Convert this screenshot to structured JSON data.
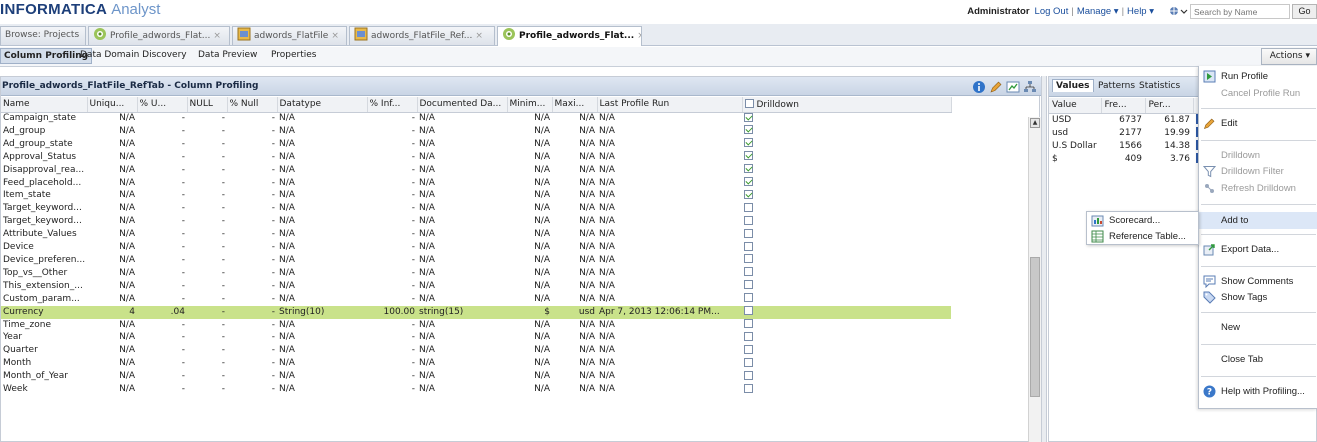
{
  "header": {
    "brand": "INFORMATICA",
    "app_name": "Analyst",
    "user": "Administrator",
    "links": [
      "Log Out",
      "Manage ▾",
      "Help ▾"
    ],
    "search_placeholder": "Search by Name",
    "go_label": "Go"
  },
  "tabs": [
    {
      "label": "Browse: Projects",
      "close": ""
    },
    {
      "label": "Profile_adwords_Flat...",
      "close": "×",
      "icon": "profile-icon"
    },
    {
      "label": "adwords_FlatFile",
      "close": "×",
      "icon": "flatfile-icon"
    },
    {
      "label": "adwords_FlatFile_Ref...",
      "close": "×",
      "icon": "flatfile-icon"
    },
    {
      "label": "Profile_adwords_Flat...",
      "close": "×",
      "icon": "profile-icon",
      "active": true
    }
  ],
  "subnav": {
    "items": [
      "Column Profiling",
      "Data Domain Discovery",
      "Data Preview",
      "Properties"
    ],
    "actions_label": "Actions ▾"
  },
  "panel": {
    "title": "Profile_adwords_FlatFile_RefTab - Column Profiling"
  },
  "grid": {
    "columns": [
      "Name",
      "Uniqu...",
      "% U...",
      "NULL",
      "% Null",
      "Datatype",
      "% Inf...",
      "Documented Da...",
      "Minim...",
      "Maxi...",
      "Last Profile Run",
      "Drilldown"
    ],
    "rows": [
      {
        "name": "Campaign_state",
        "unique": "N/A",
        "pu": "-",
        "null": "-",
        "pnull": "-",
        "datatype": "N/A",
        "pinf": "-",
        "documented": "N/A",
        "min": "N/A",
        "max": "N/A",
        "lastrun": "N/A",
        "drill": true
      },
      {
        "name": "Ad_group",
        "unique": "N/A",
        "pu": "-",
        "null": "-",
        "pnull": "-",
        "datatype": "N/A",
        "pinf": "-",
        "documented": "N/A",
        "min": "N/A",
        "max": "N/A",
        "lastrun": "N/A",
        "drill": true
      },
      {
        "name": "Ad_group_state",
        "unique": "N/A",
        "pu": "-",
        "null": "-",
        "pnull": "-",
        "datatype": "N/A",
        "pinf": "-",
        "documented": "N/A",
        "min": "N/A",
        "max": "N/A",
        "lastrun": "N/A",
        "drill": true
      },
      {
        "name": "Approval_Status",
        "unique": "N/A",
        "pu": "-",
        "null": "-",
        "pnull": "-",
        "datatype": "N/A",
        "pinf": "-",
        "documented": "N/A",
        "min": "N/A",
        "max": "N/A",
        "lastrun": "N/A",
        "drill": true
      },
      {
        "name": "Disapproval_rea...",
        "unique": "N/A",
        "pu": "-",
        "null": "-",
        "pnull": "-",
        "datatype": "N/A",
        "pinf": "-",
        "documented": "N/A",
        "min": "N/A",
        "max": "N/A",
        "lastrun": "N/A",
        "drill": true
      },
      {
        "name": "Feed_placehold...",
        "unique": "N/A",
        "pu": "-",
        "null": "-",
        "pnull": "-",
        "datatype": "N/A",
        "pinf": "-",
        "documented": "N/A",
        "min": "N/A",
        "max": "N/A",
        "lastrun": "N/A",
        "drill": true
      },
      {
        "name": "Item_state",
        "unique": "N/A",
        "pu": "-",
        "null": "-",
        "pnull": "-",
        "datatype": "N/A",
        "pinf": "-",
        "documented": "N/A",
        "min": "N/A",
        "max": "N/A",
        "lastrun": "N/A",
        "drill": true
      },
      {
        "name": "Target_keyword...",
        "unique": "N/A",
        "pu": "-",
        "null": "-",
        "pnull": "-",
        "datatype": "N/A",
        "pinf": "-",
        "documented": "N/A",
        "min": "N/A",
        "max": "N/A",
        "lastrun": "N/A",
        "drill": false
      },
      {
        "name": "Target_keyword...",
        "unique": "N/A",
        "pu": "-",
        "null": "-",
        "pnull": "-",
        "datatype": "N/A",
        "pinf": "-",
        "documented": "N/A",
        "min": "N/A",
        "max": "N/A",
        "lastrun": "N/A",
        "drill": false
      },
      {
        "name": "Attribute_Values",
        "unique": "N/A",
        "pu": "-",
        "null": "-",
        "pnull": "-",
        "datatype": "N/A",
        "pinf": "-",
        "documented": "N/A",
        "min": "N/A",
        "max": "N/A",
        "lastrun": "N/A",
        "drill": false
      },
      {
        "name": "Device",
        "unique": "N/A",
        "pu": "-",
        "null": "-",
        "pnull": "-",
        "datatype": "N/A",
        "pinf": "-",
        "documented": "N/A",
        "min": "N/A",
        "max": "N/A",
        "lastrun": "N/A",
        "drill": false
      },
      {
        "name": "Device_preferen...",
        "unique": "N/A",
        "pu": "-",
        "null": "-",
        "pnull": "-",
        "datatype": "N/A",
        "pinf": "-",
        "documented": "N/A",
        "min": "N/A",
        "max": "N/A",
        "lastrun": "N/A",
        "drill": false
      },
      {
        "name": "Top_vs__Other",
        "unique": "N/A",
        "pu": "-",
        "null": "-",
        "pnull": "-",
        "datatype": "N/A",
        "pinf": "-",
        "documented": "N/A",
        "min": "N/A",
        "max": "N/A",
        "lastrun": "N/A",
        "drill": false
      },
      {
        "name": "This_extension_...",
        "unique": "N/A",
        "pu": "-",
        "null": "-",
        "pnull": "-",
        "datatype": "N/A",
        "pinf": "-",
        "documented": "N/A",
        "min": "N/A",
        "max": "N/A",
        "lastrun": "N/A",
        "drill": false
      },
      {
        "name": "Custom_param...",
        "unique": "N/A",
        "pu": "-",
        "null": "-",
        "pnull": "-",
        "datatype": "N/A",
        "pinf": "-",
        "documented": "N/A",
        "min": "N/A",
        "max": "N/A",
        "lastrun": "N/A",
        "drill": false
      },
      {
        "name": "Currency",
        "unique": "4",
        "pu": ".04",
        "null": "-",
        "pnull": "-",
        "datatype": "String(10)",
        "pinf": "100.00",
        "documented": "string(15)",
        "min": "$",
        "max": "usd",
        "lastrun": "Apr 7, 2013 12:06:14 PM...",
        "drill": false,
        "highlight": true
      },
      {
        "name": "Time_zone",
        "unique": "N/A",
        "pu": "-",
        "null": "-",
        "pnull": "-",
        "datatype": "N/A",
        "pinf": "-",
        "documented": "N/A",
        "min": "N/A",
        "max": "N/A",
        "lastrun": "N/A",
        "drill": false
      },
      {
        "name": "Year",
        "unique": "N/A",
        "pu": "-",
        "null": "-",
        "pnull": "-",
        "datatype": "N/A",
        "pinf": "-",
        "documented": "N/A",
        "min": "N/A",
        "max": "N/A",
        "lastrun": "N/A",
        "drill": false
      },
      {
        "name": "Quarter",
        "unique": "N/A",
        "pu": "-",
        "null": "-",
        "pnull": "-",
        "datatype": "N/A",
        "pinf": "-",
        "documented": "N/A",
        "min": "N/A",
        "max": "N/A",
        "lastrun": "N/A",
        "drill": false
      },
      {
        "name": "Month",
        "unique": "N/A",
        "pu": "-",
        "null": "-",
        "pnull": "-",
        "datatype": "N/A",
        "pinf": "-",
        "documented": "N/A",
        "min": "N/A",
        "max": "N/A",
        "lastrun": "N/A",
        "drill": false
      },
      {
        "name": "Month_of_Year",
        "unique": "N/A",
        "pu": "-",
        "null": "-",
        "pnull": "-",
        "datatype": "N/A",
        "pinf": "-",
        "documented": "N/A",
        "min": "N/A",
        "max": "N/A",
        "lastrun": "N/A",
        "drill": false
      },
      {
        "name": "Week",
        "unique": "N/A",
        "pu": "-",
        "null": "-",
        "pnull": "-",
        "datatype": "N/A",
        "pinf": "-",
        "documented": "N/A",
        "min": "N/A",
        "max": "N/A",
        "lastrun": "N/A",
        "drill": false
      }
    ]
  },
  "values_panel": {
    "tabs": [
      "Values",
      "Patterns",
      "Statistics"
    ],
    "columns": [
      "Value",
      "Fre...",
      "Per..."
    ],
    "rows": [
      {
        "value": "USD",
        "freq": "6737",
        "pct": "61.87"
      },
      {
        "value": "usd",
        "freq": "2177",
        "pct": "19.99"
      },
      {
        "value": "U.S Dollar",
        "freq": "1566",
        "pct": "14.38"
      },
      {
        "value": "$",
        "freq": "409",
        "pct": "3.76"
      }
    ]
  },
  "actions_menu": {
    "items": [
      {
        "label": "Run Profile",
        "icon": "run-profile-icon",
        "disabled": false
      },
      {
        "label": "Cancel Profile Run",
        "icon": "",
        "disabled": true
      },
      {
        "label": "Edit",
        "icon": "pencil-icon",
        "disabled": false
      },
      {
        "label": "Drilldown",
        "icon": "",
        "disabled": true
      },
      {
        "label": "Drilldown Filter",
        "icon": "filter-icon",
        "disabled": true
      },
      {
        "label": "Refresh Drilldown",
        "icon": "refresh-icon",
        "disabled": true
      },
      {
        "label": "Add to",
        "icon": "",
        "disabled": false,
        "hover": true
      },
      {
        "label": "Export Data...",
        "icon": "export-icon",
        "disabled": false
      },
      {
        "label": "Show Comments",
        "icon": "comment-icon",
        "disabled": false
      },
      {
        "label": "Show Tags",
        "icon": "tag-icon",
        "disabled": false
      },
      {
        "label": "New",
        "icon": "",
        "disabled": false
      },
      {
        "label": "Close Tab",
        "icon": "",
        "disabled": false
      },
      {
        "label": "Help with Profiling...",
        "icon": "help-icon",
        "disabled": false
      }
    ]
  },
  "add_to_submenu": {
    "items": [
      {
        "label": "Scorecard...",
        "icon": "scorecard-icon"
      },
      {
        "label": "Reference Table...",
        "icon": "reference-table-icon"
      }
    ]
  },
  "colors": {
    "highlight_row": "#c9e28a",
    "brand": "#1d3f7a",
    "link": "#1a4e9c",
    "bar": "#2e5aa8"
  }
}
